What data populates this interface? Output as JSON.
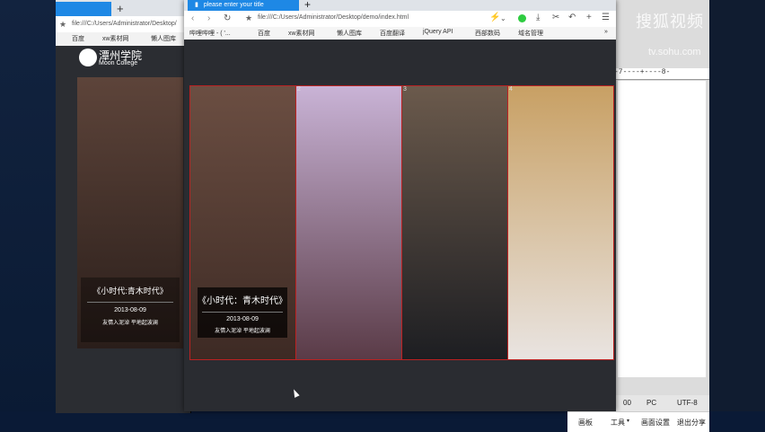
{
  "back_window": {
    "url": "file:///C:/Users/Administrator/Desktop/",
    "bookmarks": [
      "百度",
      "xw素材网",
      "懒人图库"
    ],
    "plus": "+"
  },
  "window": {
    "tab_title": "please enter your title",
    "new_tab": "+",
    "url": "file:///C:/Users/Administrator/Desktop/demo/index.html",
    "bookmarks": [
      "哔哩哔哩 - ( '...",
      "百度",
      "xw素材网",
      "懒人图库",
      "百度翻译",
      "jQuery API",
      "西部数码",
      "域名管理"
    ],
    "more": "»"
  },
  "logo": {
    "name": "潭州学院",
    "sub": "Moon College"
  },
  "gallery": {
    "panels": [
      {
        "number": "",
        "title": "《小时代：青木时代》",
        "date": "2013-08-09",
        "subtitle": "友情入泥淖 平地起波澜",
        "colors": [
          "#6b4e42",
          "#3d2a24"
        ]
      },
      {
        "number": "2",
        "colors": [
          "#c9b3d6",
          "#5a3b47"
        ]
      },
      {
        "number": "3",
        "colors": [
          "#6b5a4c",
          "#1d1e22"
        ]
      },
      {
        "number": "4",
        "colors": [
          "#c8a064",
          "#e9e4e1"
        ]
      }
    ]
  },
  "back_caption": {
    "title": "《小时代:青木时代》",
    "date": "2013-08-09",
    "subtitle": "友情入泥淖 平地起波澜"
  },
  "right_app": {
    "ruler": "-7----+----8-",
    "status": [
      "00",
      "PC",
      "UTF-8"
    ]
  },
  "bottom_bar": [
    "画板",
    "工具",
    "画面设置",
    "退出分享"
  ],
  "watermark": {
    "main": "搜狐视频",
    "sub": "tv.sohu.com"
  }
}
